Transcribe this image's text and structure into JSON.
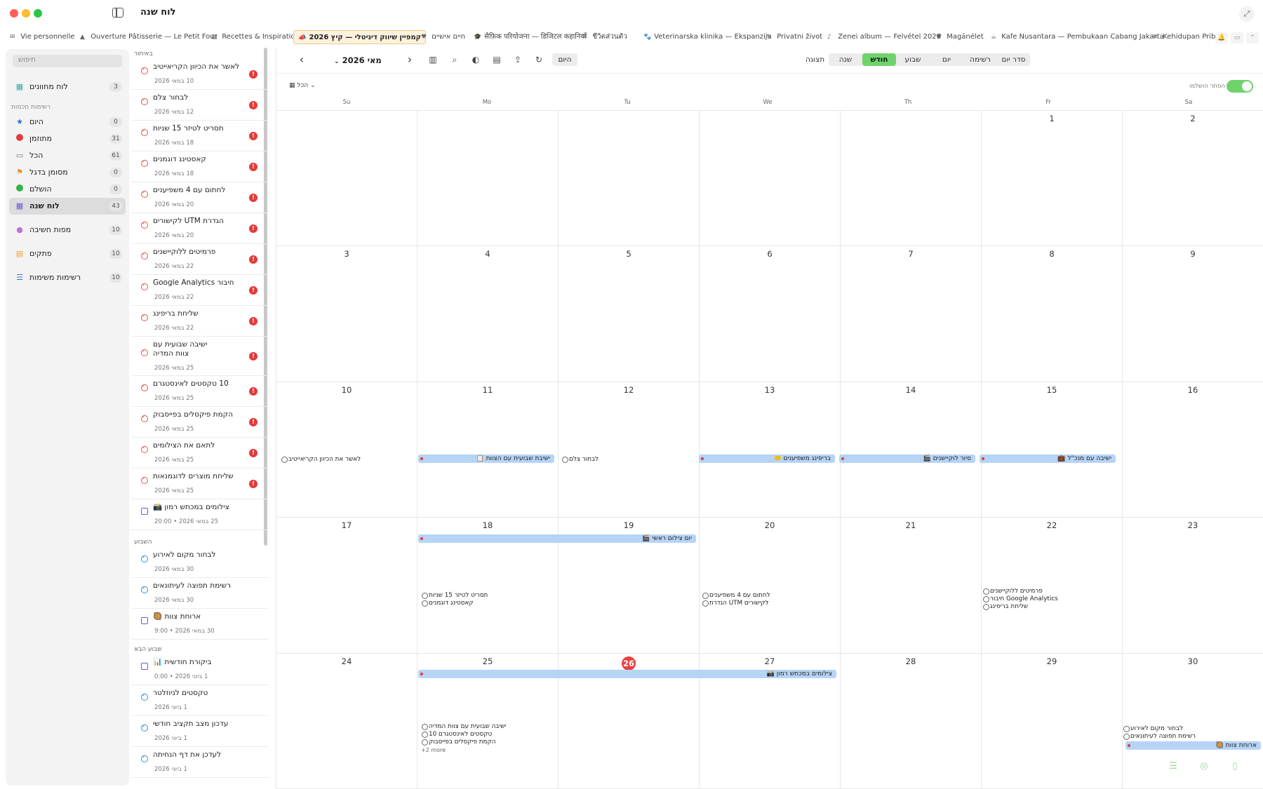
{
  "window": {
    "title": "לוח שנה",
    "expand_icon": "expand-icon"
  },
  "tabs": [
    {
      "label": "Vie personnelle",
      "icon": "✉"
    },
    {
      "label": "Ouverture Pâtisserie — Le Petit Four",
      "icon": "▲"
    },
    {
      "label": "Recettes & Inspirations",
      "icon": "▤"
    },
    {
      "label": "קמפיין שיווק דיגיטלי — קיץ 2026",
      "icon": "📣"
    },
    {
      "label": "חיים אישיים",
      "icon": "♥"
    },
    {
      "label": "सैफ़िक परियोजना — डिजिटल कहानियाँ",
      "icon": "🎓"
    },
    {
      "label": "ชีวิตส่วนตัว",
      "icon": "✉"
    },
    {
      "label": "Veterinarska klinika — Ekspanzija",
      "icon": "🐾"
    },
    {
      "label": "Privatni život",
      "icon": "✎"
    },
    {
      "label": "Zenei album — Felvétel 2026",
      "icon": "♪"
    },
    {
      "label": "Magánélet",
      "icon": "♥"
    },
    {
      "label": "Kafe Nusantara — Pembukaan Cabang Jakarta",
      "icon": "☕"
    },
    {
      "label": "Kehidupan Prib…",
      "icon": "✉"
    }
  ],
  "sidebar": {
    "search_placeholder": "חיפוש",
    "pinned": {
      "label": "לוח מחוונים",
      "count": "3"
    },
    "smart_lists_title": "רשימות חכמות",
    "smart_lists": [
      {
        "label": "היום",
        "count": "0",
        "icon": "star-icon"
      },
      {
        "label": "מתוזמן",
        "count": "31",
        "icon": "clock-icon"
      },
      {
        "label": "הכל",
        "count": "61",
        "icon": "tray-icon"
      },
      {
        "label": "מסומן בדגל",
        "count": "0",
        "icon": "flag-icon"
      },
      {
        "label": "הושלם",
        "count": "0",
        "icon": "check-icon"
      },
      {
        "label": "לוח שנה",
        "count": "43",
        "icon": "calendar-icon"
      }
    ],
    "others": [
      {
        "label": "מפות חשיבה",
        "count": "10",
        "icon": "brain-icon"
      },
      {
        "label": "פתקים",
        "count": "10",
        "icon": "note-icon"
      },
      {
        "label": "רשימות משימות",
        "count": "10",
        "icon": "checklist-icon"
      }
    ]
  },
  "tasklist": {
    "sections": {
      "overdue": "באיחור",
      "this_week": "השבוע",
      "next_week": "שבוע הבא"
    },
    "overdue": [
      {
        "title": "לאשר את הכיוון הקריאייטיב",
        "date": "10 במאי 2026"
      },
      {
        "title": "לבחור צלם",
        "date": "12 במאי 2026"
      },
      {
        "title": "תסריט לטיזר 15 שניות",
        "date": "18 במאי 2026"
      },
      {
        "title": "קאסטינג דוגמנים",
        "date": "18 במאי 2026"
      },
      {
        "title": "לחתום עם 4 משפיענים",
        "date": "20 במאי 2026"
      },
      {
        "title": "הגדרת UTM לקישורים",
        "date": "20 במאי 2026"
      },
      {
        "title": "פרמיטים ללוקיישנים",
        "date": "22 במאי 2026"
      },
      {
        "title": "חיבור Google Analytics",
        "date": "22 במאי 2026"
      },
      {
        "title": "שליחת בריפינג",
        "date": "22 במאי 2026"
      },
      {
        "title": "ישיבה שבועית עם צוות המדיה",
        "date": "25 במאי 2026"
      },
      {
        "title": "10 טקסטים לאינסטגרם",
        "date": "25 במאי 2026"
      },
      {
        "title": "הקמת פיקסלים בפייסבוק",
        "date": "25 במאי 2026"
      },
      {
        "title": "לתאם את הצילומים",
        "date": "25 במאי 2026"
      },
      {
        "title": "שליחת מוצרים לדוגמנאות",
        "date": "25 במאי 2026"
      },
      {
        "title": "צילומים במכתש רמון 📸",
        "date": "25 במאי 2026 • 20:00"
      }
    ],
    "this_week": [
      {
        "title": "לבחור מקום לאירוע",
        "date": "30 במאי 2026"
      },
      {
        "title": "רשימת תפוצה לעיתונאים",
        "date": "30 במאי 2026"
      },
      {
        "title": "ארוחת צוות 🥘",
        "date": "30 במאי 2026 • 9:00"
      }
    ],
    "next_week": [
      {
        "title": "ביקורת חודשית 📊",
        "date": "1 ביוני 2026 • 0:00"
      },
      {
        "title": "טקסטים לניוזלטר",
        "date": "1 ביוני 2026"
      },
      {
        "title": "עדכון מצב תקציב חודשי",
        "date": "1 ביוני 2026"
      },
      {
        "title": "לעדכן את דף הנחיתה",
        "date": "1 ביוני 2026"
      }
    ]
  },
  "calendar": {
    "month_label": "מאי 2026",
    "today_label": "היום",
    "display_label": "תצוגה",
    "views": [
      "סדר יום",
      "רשימה",
      "יום",
      "שבוע",
      "חודש",
      "שנה"
    ],
    "active_view": "חודש",
    "filter_label": "הכל",
    "hide_completed_label": "הסתר הושלמו",
    "weekdays": [
      "Su",
      "Mo",
      "Tu",
      "We",
      "Th",
      "Fr",
      "Sa"
    ],
    "weeks": [
      [
        "",
        "",
        "",
        "",
        "",
        "1",
        "2"
      ],
      [
        "3",
        "4",
        "5",
        "6",
        "7",
        "8",
        "9"
      ],
      [
        "10",
        "11",
        "12",
        "13",
        "14",
        "15",
        "16"
      ],
      [
        "17",
        "18",
        "19",
        "20",
        "21",
        "22",
        "23"
      ],
      [
        "24",
        "25",
        "26",
        "27",
        "28",
        "29",
        "30"
      ]
    ],
    "today": "26",
    "events": {
      "w3_task": "לאשר את הכיוון הקריאייטיב",
      "w3_mo": "ישיבת שבועית עם הצוות 📋",
      "w3_tu": "לבחור צלם",
      "w3_we": "בריפינג משפיענים 🤝",
      "w3_th": "סיור לוקיישנים 🎬",
      "w3_fr": "ישיבה עם מנכ\"ל 💼",
      "w4_bar": "יום צילום ראשי 🎬",
      "w4_mo1": "תסריט לטיזר 15 שניות",
      "w4_mo2": "קאסטינג דוגמנים",
      "w4_we1": "לחתום עם 4 משפיענים",
      "w4_we2": "הגדרת UTM לקישורים",
      "w4_fr1": "פרמיטים ללוקיישנים",
      "w4_fr2": "חיבור Google Analytics",
      "w4_fr3": "שליחת בריפינג",
      "w5_bar": "צילומים במכתש רמון 📸",
      "w5_mo1": "ישיבה שבועית עם צוות המדיה",
      "w5_mo2": "10 טקסטים לאינסטגרם",
      "w5_mo3": "הקמת פיקסלים בפייסבוק",
      "w5_more": "+2 more",
      "w5_sa1": "לבחור מקום לאירוע",
      "w5_sa2": "רשימת תפוצה לעיתונאים",
      "w5_sa_bar": "ארוחת צוות 🥘"
    }
  }
}
